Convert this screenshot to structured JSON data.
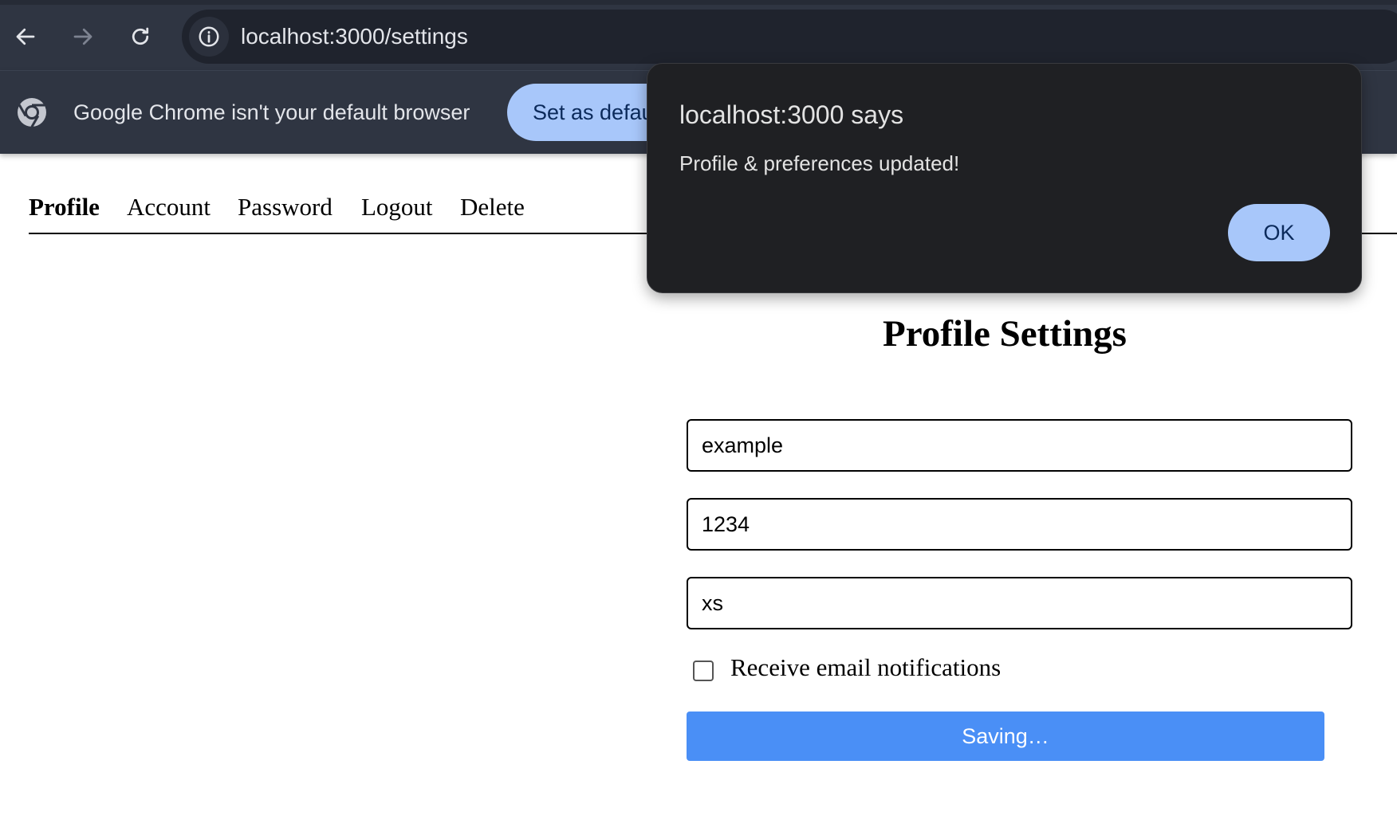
{
  "browser": {
    "url": "localhost:3000/settings",
    "icons": {
      "back": "arrow-left-icon",
      "forward": "arrow-right-icon",
      "reload": "reload-icon",
      "site_info": "info-icon",
      "chrome": "chrome-logo-icon"
    },
    "infobar": {
      "message": "Google Chrome isn't your default browser",
      "button_label": "Set as default"
    }
  },
  "settings_nav": {
    "items": [
      {
        "label": "Profile",
        "active": true
      },
      {
        "label": "Account",
        "active": false
      },
      {
        "label": "Password",
        "active": false
      },
      {
        "label": "Logout",
        "active": false
      },
      {
        "label": "Delete",
        "active": false
      }
    ]
  },
  "form": {
    "title": "Profile Settings",
    "fields": [
      {
        "value": "example"
      },
      {
        "value": "1234"
      },
      {
        "value": "xs"
      }
    ],
    "checkbox": {
      "label": "Receive email notifications",
      "checked": false
    },
    "submit_label": "Saving…"
  },
  "alert": {
    "title": "localhost:3000 says",
    "message": "Profile & preferences updated!",
    "ok_label": "OK"
  },
  "colors": {
    "chrome_toolbar": "#2f3542",
    "accent_button": "#a8c7fa",
    "save_button": "#4a8ff6",
    "dialog_bg": "#1f2023"
  }
}
